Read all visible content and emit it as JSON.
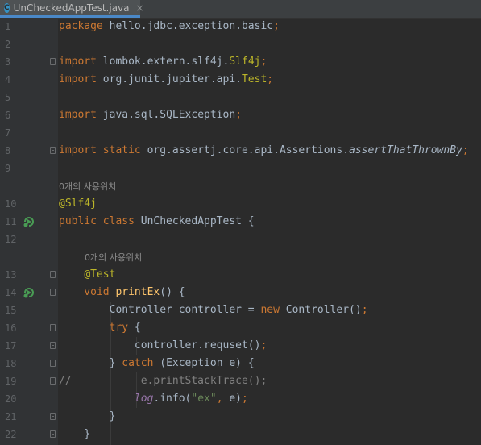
{
  "tab": {
    "filename": "UnCheckedAppTest.java",
    "icon_letter": "C",
    "close_glyph": "×"
  },
  "hints": {
    "usages": "0개의 사용위치"
  },
  "lines": [
    {
      "n": "1",
      "segments": [
        [
          "kw",
          "package "
        ],
        [
          "fg",
          "hello.jdbc.exception.basic"
        ],
        [
          "kw",
          ";"
        ]
      ]
    },
    {
      "n": "2",
      "segments": []
    },
    {
      "n": "3",
      "segments": [
        [
          "kw",
          "import "
        ],
        [
          "fg",
          "lombok.extern.slf4j."
        ],
        [
          "ann",
          "Slf4j"
        ],
        [
          "kw",
          ";"
        ]
      ]
    },
    {
      "n": "4",
      "segments": [
        [
          "kw",
          "import "
        ],
        [
          "fg",
          "org.junit.jupiter.api."
        ],
        [
          "ann",
          "Test"
        ],
        [
          "kw",
          ";"
        ]
      ]
    },
    {
      "n": "5",
      "segments": []
    },
    {
      "n": "6",
      "segments": [
        [
          "kw",
          "import "
        ],
        [
          "fg",
          "java.sql.SQLException"
        ],
        [
          "kw",
          ";"
        ]
      ]
    },
    {
      "n": "7",
      "segments": []
    },
    {
      "n": "8",
      "segments": [
        [
          "kw",
          "import static "
        ],
        [
          "fg",
          "org.assertj.core.api.Assertions."
        ],
        [
          "fg it",
          "assertThatThrownBy"
        ],
        [
          "kw",
          ";"
        ]
      ]
    },
    {
      "n": "9",
      "segments": []
    },
    {
      "n": "10",
      "segments": [
        [
          "ann",
          "@Slf4j"
        ]
      ]
    },
    {
      "n": "11",
      "segments": [
        [
          "kw",
          "public class "
        ],
        [
          "fg",
          "UnCheckedAppTest {"
        ]
      ]
    },
    {
      "n": "12",
      "segments": []
    },
    {
      "n": "13",
      "segments": [
        [
          "fg",
          "    "
        ],
        [
          "ann",
          "@Test"
        ]
      ]
    },
    {
      "n": "14",
      "segments": [
        [
          "kw",
          "    void "
        ],
        [
          "fn",
          "printEx"
        ],
        [
          "fg",
          "() {"
        ]
      ]
    },
    {
      "n": "15",
      "segments": [
        [
          "fg",
          "        Controller controller = "
        ],
        [
          "kw",
          "new "
        ],
        [
          "fg",
          "Controller()"
        ],
        [
          "kw",
          ";"
        ]
      ]
    },
    {
      "n": "16",
      "segments": [
        [
          "kw",
          "        try "
        ],
        [
          "fg",
          "{"
        ]
      ]
    },
    {
      "n": "17",
      "segments": [
        [
          "fg",
          "            controller.requset()"
        ],
        [
          "kw",
          ";"
        ]
      ]
    },
    {
      "n": "18",
      "segments": [
        [
          "fg",
          "        } "
        ],
        [
          "kw",
          "catch "
        ],
        [
          "fg",
          "(Exception e) {"
        ]
      ]
    },
    {
      "n": "19",
      "segments": [
        [
          "cmt",
          "//           e.printStackTrace();"
        ]
      ]
    },
    {
      "n": "20",
      "segments": [
        [
          "fld",
          "            log"
        ],
        [
          "fg",
          ".info("
        ],
        [
          "str",
          "\"ex\""
        ],
        [
          "kw",
          ", "
        ],
        [
          "fg",
          "e)"
        ],
        [
          "kw",
          ";"
        ]
      ]
    },
    {
      "n": "21",
      "segments": [
        [
          "fg",
          "        }"
        ]
      ]
    },
    {
      "n": "22",
      "segments": [
        [
          "fg",
          "    }"
        ]
      ]
    }
  ]
}
